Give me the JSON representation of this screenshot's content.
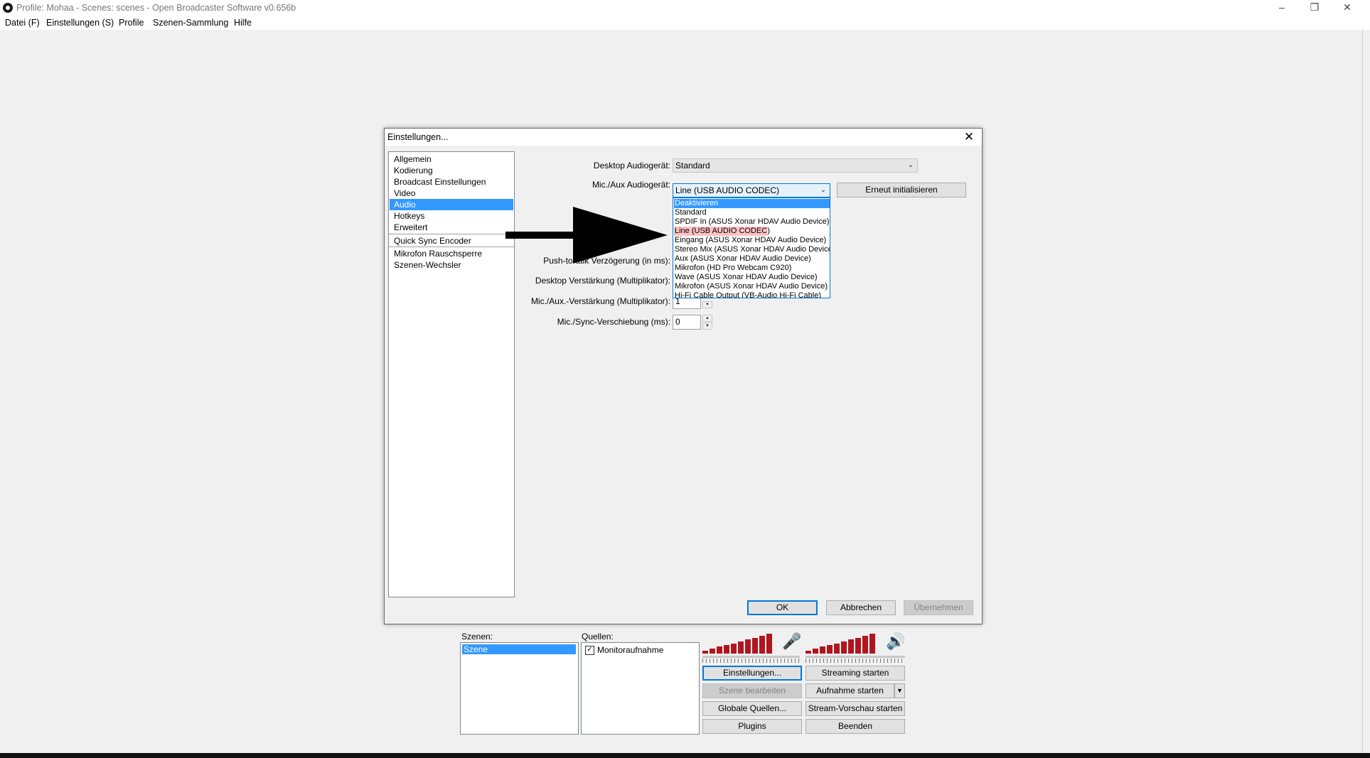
{
  "window": {
    "title": "Profile: Mohaa - Scenes: scenes - Open Broadcaster Software v0.656b",
    "minimize_icon": "minimize-icon",
    "maximize_icon": "restore-icon",
    "close_icon": "close-icon"
  },
  "menubar": {
    "items": [
      "Datei (F)",
      "Einstellungen (S)",
      "Profile",
      "Szenen-Sammlung",
      "Hilfe"
    ]
  },
  "dialog": {
    "title": "Einstellungen...",
    "nav": {
      "items": [
        "Allgemein",
        "Kodierung",
        "Broadcast Einstellungen",
        "Video",
        "Audio",
        "Hotkeys",
        "Erweitert",
        "Quick Sync Encoder",
        "Mikrofon Rauschsperre",
        "Szenen-Wechsler"
      ],
      "selected": "Audio"
    },
    "audio": {
      "desktop_device_label": "Desktop Audiogerät:",
      "desktop_device_value": "Standard",
      "mic_device_label": "Mic./Aux Audiogerät:",
      "mic_device_value": "Line (USB AUDIO  CODEC)",
      "reinit_button": "Erneut initialisieren",
      "dropdown_options": [
        "Deaktivieren",
        "Standard",
        "SPDIF In (ASUS Xonar HDAV Audio Device)",
        "Line (USB AUDIO  CODEC)",
        "Eingang (ASUS Xonar HDAV Audio Device)",
        "Stereo Mix (ASUS Xonar HDAV Audio Device)",
        "Aux (ASUS Xonar HDAV Audio Device)",
        "Mikrofon (HD Pro Webcam C920)",
        "Wave (ASUS Xonar HDAV Audio Device)",
        "Mikrofon (ASUS Xonar HDAV Audio Device)",
        "Hi-Fi Cable Output (VB-Audio Hi-Fi Cable)"
      ],
      "dropdown_highlighted": "Deaktivieren",
      "dropdown_marked": "Line (USB AUDIO  CODEC)",
      "ptt_delay_label": "Push-to-talk Verzögerung (in ms):",
      "desktop_gain_label": "Desktop Verstärkung (Multiplikator):",
      "mic_gain_label": "Mic./Aux.-Verstärkung (Multiplikator):",
      "mic_gain_value": "1",
      "mic_sync_label": "Mic./Sync-Verschiebung (ms):",
      "mic_sync_value": "0"
    },
    "buttons": {
      "ok": "OK",
      "cancel": "Abbrechen",
      "apply": "Übernehmen"
    },
    "annotation": {
      "arrow_icon": "arrow-right-icon",
      "arrow_color": "#000000",
      "marker_color": "#ff9a9a"
    }
  },
  "main_panel": {
    "scenes_label": "Szenen:",
    "scenes": [
      "Szene"
    ],
    "sources_label": "Quellen:",
    "sources": [
      {
        "name": "Monitoraufnahme",
        "checked": true
      }
    ],
    "mic_icon": "microphone-icon",
    "speaker_icon": "speaker-icon",
    "meter_color": "#b0161e",
    "buttons": {
      "settings": "Einstellungen...",
      "start_streaming": "Streaming starten",
      "edit_scene": "Szene bearbeiten",
      "start_recording": "Aufnahme starten",
      "recording_menu_icon": "dropdown-arrow-icon",
      "global_sources": "Globale Quellen...",
      "preview": "Stream-Vorschau starten",
      "plugins": "Plugins",
      "exit": "Beenden"
    }
  }
}
